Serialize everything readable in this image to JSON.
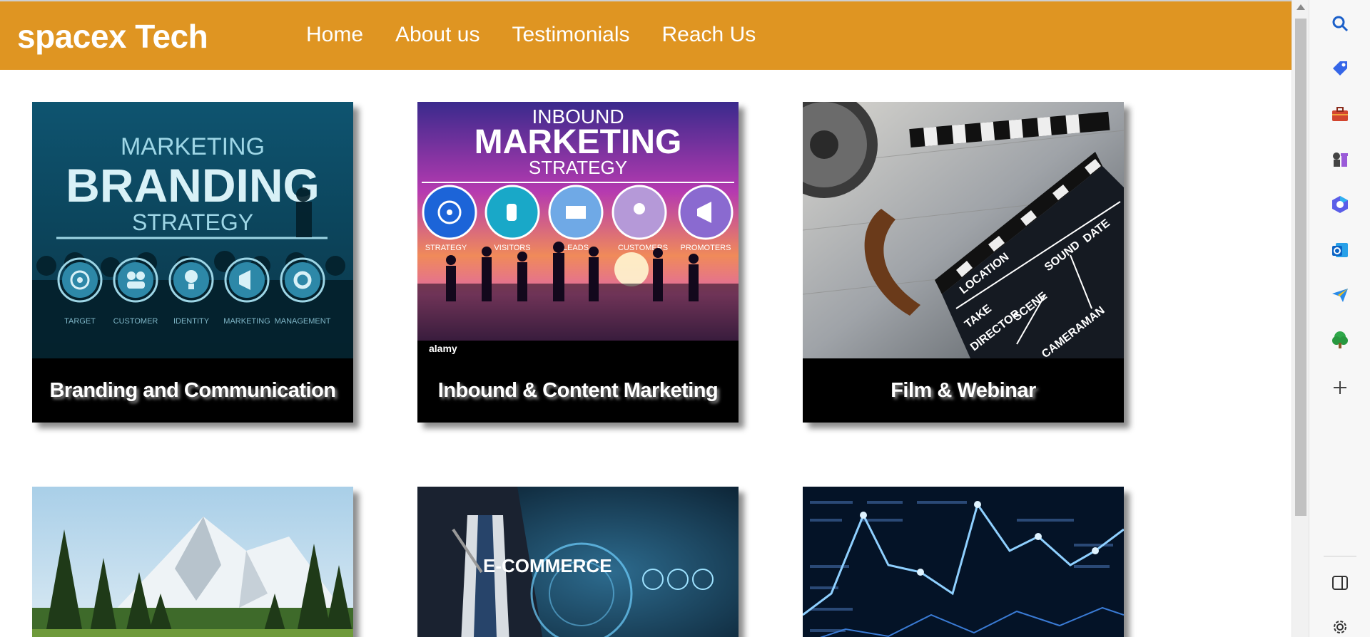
{
  "brand": "spacex Tech",
  "nav": [
    "Home",
    "About us",
    "Testimonials",
    "Reach Us"
  ],
  "cards": [
    {
      "title": "Branding and Communication",
      "image": {
        "top": "MARKETING",
        "main": "BRANDING",
        "sub": "STRATEGY",
        "icons": [
          "TARGET",
          "CUSTOMER",
          "IDENTITY",
          "MARKETING",
          "MANAGEMENT"
        ]
      }
    },
    {
      "title": "Inbound & Content Marketing",
      "image": {
        "top": "INBOUND",
        "main": "MARKETING",
        "sub": "STRATEGY",
        "icons": [
          "STRATEGY",
          "VISITORS",
          "LEADS",
          "CUSTOMERS",
          "PROMOTERS"
        ],
        "watermark": "alamy"
      }
    },
    {
      "title": "Film & Webinar",
      "image": {
        "clapper": [
          "LOCATION",
          "SOUND",
          "DATE",
          "TAKE",
          "SCENE",
          "DIRECTOR",
          "CAMERAMAN"
        ]
      }
    },
    {
      "title": "",
      "image": {
        "scene": "mountain-forest"
      }
    },
    {
      "title": "",
      "image": {
        "label": "E-COMMERCE"
      }
    },
    {
      "title": "",
      "image": {
        "scene": "stock-chart"
      }
    }
  ],
  "sidebar_icons": [
    "search-icon",
    "tag-icon",
    "toolbox-icon",
    "chess-icon",
    "copilot-icon",
    "outlook-icon",
    "send-icon",
    "tree-icon",
    "add-icon",
    "split-view-icon",
    "settings-icon"
  ],
  "colors": {
    "navbar": "#df9522",
    "card_caption_bg": "#000000"
  }
}
